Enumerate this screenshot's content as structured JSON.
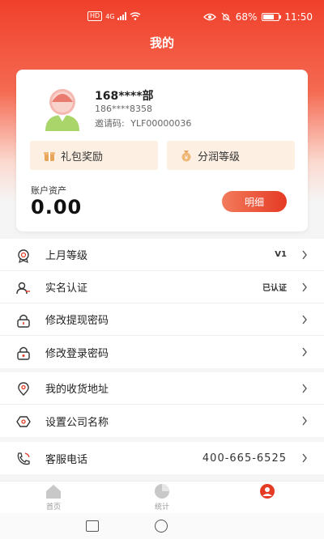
{
  "status_bar": {
    "left_badge": "HD",
    "network": "4G",
    "battery": "68%",
    "time": "11:50"
  },
  "header": {
    "title": "我的"
  },
  "profile": {
    "name": "168****部",
    "phone": "186****8358",
    "invite_label": "邀请码:",
    "invite_code": "YLF00000036"
  },
  "card_buttons": {
    "gift": "礼包奖励",
    "level": "分润等级"
  },
  "assets": {
    "label": "账户资产",
    "value": "0.00",
    "detail_button": "明细"
  },
  "menu_group_1": [
    {
      "label": "上月等级",
      "value": "V1",
      "icon": "level-badge-icon"
    },
    {
      "label": "实名认证",
      "value": "已认证",
      "icon": "user-verify-icon"
    },
    {
      "label": "修改提现密码",
      "value": "",
      "icon": "lock-icon"
    },
    {
      "label": "修改登录密码",
      "value": "",
      "icon": "lock-icon"
    }
  ],
  "menu_group_2": [
    {
      "label": "我的收货地址",
      "value": "",
      "icon": "location-icon"
    },
    {
      "label": "设置公司名称",
      "value": "",
      "icon": "company-icon"
    }
  ],
  "menu_group_3": [
    {
      "label": "客服电话",
      "value": "400-665-6525",
      "icon": "phone-icon"
    }
  ],
  "tabbar": {
    "home": "首页",
    "stats": "统计",
    "mine": ""
  },
  "colors": {
    "brand": "#e53a24",
    "card_button_bg": "#fdf0e3"
  }
}
